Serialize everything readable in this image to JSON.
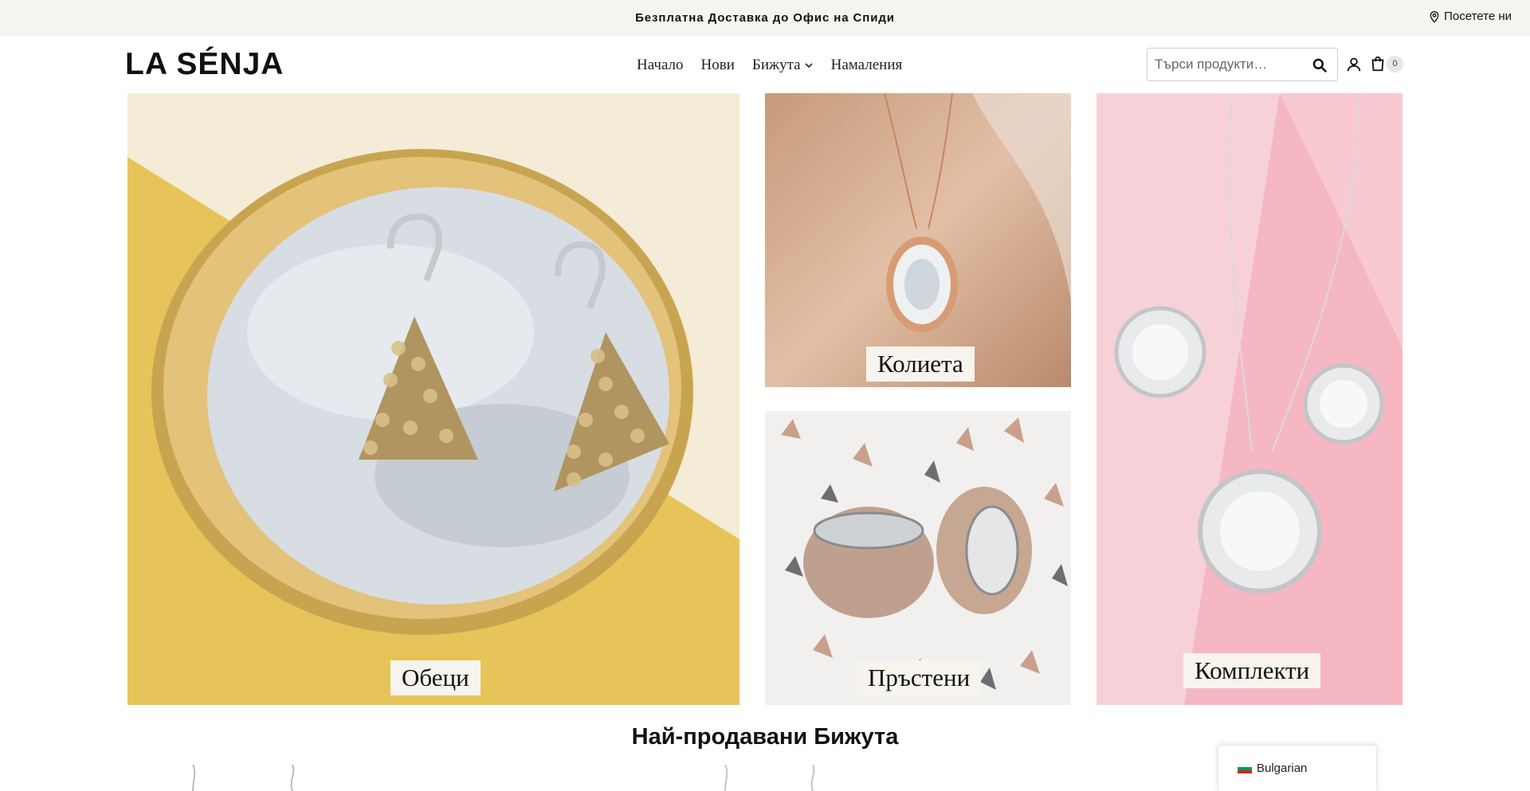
{
  "topbar": {
    "promo": "Безплатна Доставка до Офис на Спиди",
    "visit_label": "Посетете ни"
  },
  "header": {
    "logo": "LA SÉNJA",
    "nav": [
      {
        "label": "Начало"
      },
      {
        "label": "Нови"
      },
      {
        "label": "Бижута"
      },
      {
        "label": "Намаления"
      }
    ],
    "search_placeholder": "Търси продукти…",
    "cart_count": "0"
  },
  "categories": [
    {
      "label": "Обеци"
    },
    {
      "label": "Колиета"
    },
    {
      "label": "Пръстени"
    },
    {
      "label": "Комплекти"
    }
  ],
  "section_title": "Най-продавани Бижута",
  "language": {
    "label": "Bulgarian"
  },
  "icons": [
    "location-pin-icon",
    "chevron-down-icon",
    "search-icon",
    "user-icon",
    "cart-icon",
    "bulgaria-flag-icon"
  ]
}
